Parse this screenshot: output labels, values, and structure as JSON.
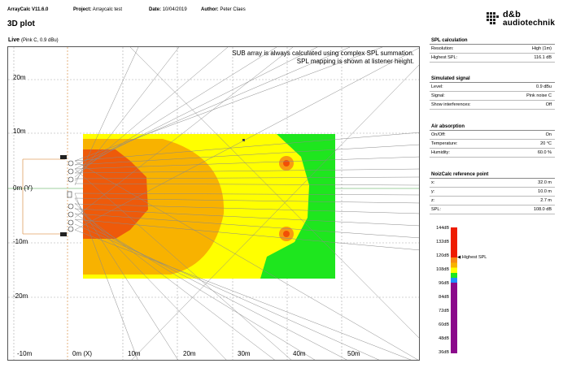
{
  "header": {
    "app_label": "ArrayCalc V11.6.0",
    "project_key": "Project:",
    "project_value": "Arraycalc test",
    "date_key": "Date:",
    "date_value": "10/04/2019",
    "author_key": "Author:",
    "author_value": "Peter Claes",
    "page_title": "3D plot"
  },
  "logo": {
    "line1": "d&b",
    "line2": "audiotechnik"
  },
  "plot": {
    "live_label": "Live",
    "live_detail": "(Pink C, 0.9 dBu)",
    "note_line1": "SUB array is always calculated using complex SPL summation.",
    "note_line2": "SPL mapping is shown at listener height.",
    "y_ticks": [
      "20m",
      "10m",
      "0m (Y)",
      "-10m",
      "-20m"
    ],
    "x_ticks": [
      "-10m",
      "0m (X)",
      "10m",
      "20m",
      "30m",
      "40m",
      "50m"
    ]
  },
  "spl_calculation": {
    "title": "SPL calculation",
    "rows": [
      {
        "label": "Resolution:",
        "value": "High (1m)"
      },
      {
        "label": "Highest SPL:",
        "value": "116.1 dB"
      }
    ]
  },
  "simulated_signal": {
    "title": "Simulated signal",
    "rows": [
      {
        "label": "Level:",
        "value": "0.9 dBu"
      },
      {
        "label": "Signal:",
        "value": "Pink noise C"
      },
      {
        "label": "Show interferences:",
        "value": "Off"
      }
    ]
  },
  "air_absorption": {
    "title": "Air absorption",
    "rows": [
      {
        "label": "On/Off:",
        "value": "On"
      },
      {
        "label": "Temperature:",
        "value": "20 °C"
      },
      {
        "label": "Humidity:",
        "value": "60.0 %"
      }
    ]
  },
  "noizcalc": {
    "title": "NoizCalc reference point",
    "rows": [
      {
        "label": "x:",
        "value": "32.0 m"
      },
      {
        "label": "y:",
        "value": "10.0 m"
      },
      {
        "label": "z:",
        "value": "2.7 m"
      },
      {
        "label": "SPL:",
        "value": "108.0 dB"
      }
    ]
  },
  "scale": {
    "labels": [
      "144dB",
      "132dB",
      "120dB",
      "108dB",
      "96dB",
      "84dB",
      "72dB",
      "60dB",
      "48dB",
      "36dB"
    ],
    "highest_marker": "Highest SPL",
    "colors": {
      "red": "#ee1c00",
      "orange": "#f78a14",
      "amber": "#f8b200",
      "yellow": "#ffff00",
      "green": "#1ee61e",
      "blue": "#1e90ff",
      "purple": "#8b0a8b"
    }
  }
}
